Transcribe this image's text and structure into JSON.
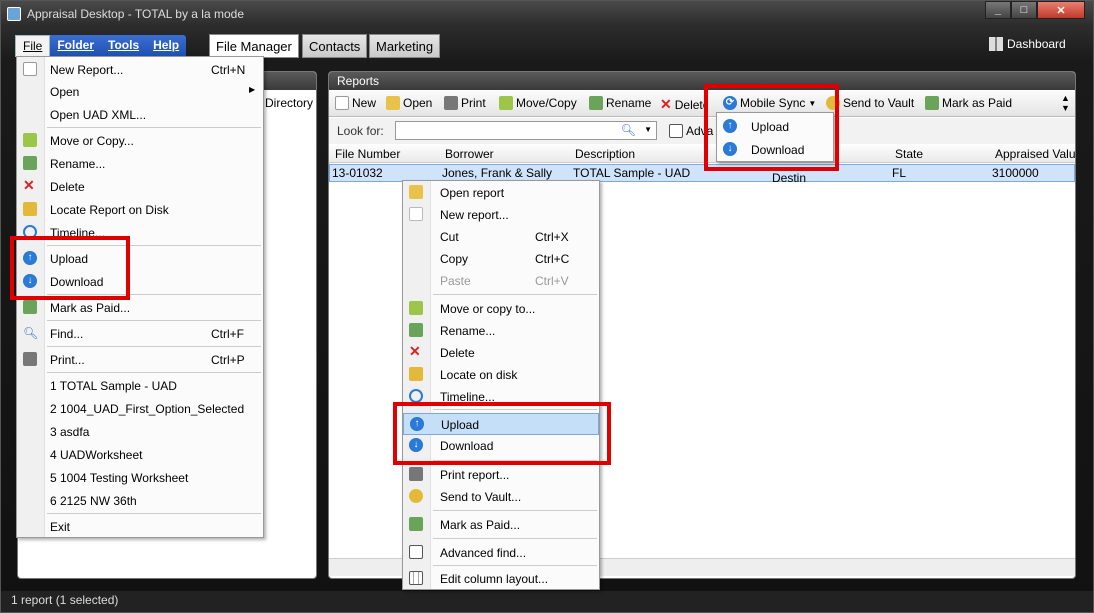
{
  "window": {
    "title": "Appraisal Desktop - TOTAL by a la mode"
  },
  "menubar": {
    "items": [
      "File",
      "Folder",
      "Tools",
      "Help"
    ]
  },
  "tabs": [
    "File Manager",
    "Contacts",
    "Marketing"
  ],
  "dashboard": {
    "label": "Dashboard"
  },
  "left_panel": {
    "directory_label": "Directory"
  },
  "reports": {
    "header": "Reports",
    "toolbar": [
      "New",
      "Open",
      "Print",
      "Move/Copy",
      "Rename",
      "Delete",
      "Mobile Sync",
      "Send to Vault",
      "Mark as Paid"
    ],
    "look_for_label": "Look for:",
    "look_for_value": "",
    "advanced_label": "Adva",
    "columns": [
      "File Number",
      "Borrower",
      "Description",
      "State",
      "Appraised Valu"
    ],
    "row": {
      "file_number": "13-01032",
      "borrower": "Jones, Frank & Sally",
      "description": "TOTAL Sample - UAD",
      "city_partial": "Destin",
      "state": "FL",
      "appraised_value": "3100000"
    }
  },
  "file_menu": {
    "new_report": "New Report...",
    "new_report_sc": "Ctrl+N",
    "open": "Open",
    "open_uad": "Open UAD XML...",
    "move_copy": "Move or Copy...",
    "rename": "Rename...",
    "delete": "Delete",
    "locate": "Locate Report on Disk",
    "timeline": "Timeline...",
    "upload": "Upload",
    "download": "Download",
    "mark_paid": "Mark as Paid...",
    "find": "Find...",
    "find_sc": "Ctrl+F",
    "print": "Print...",
    "print_sc": "Ctrl+P",
    "recent": [
      "1  TOTAL Sample - UAD",
      "2  1004_UAD_First_Option_Selected",
      "3  asdfa",
      "4  UADWorksheet",
      "5  1004 Testing Worksheet",
      "6  2125 NW 36th"
    ],
    "exit": "Exit"
  },
  "context_menu": {
    "open_report": "Open report",
    "new_report": "New report...",
    "cut": "Cut",
    "cut_sc": "Ctrl+X",
    "copy": "Copy",
    "copy_sc": "Ctrl+C",
    "paste": "Paste",
    "paste_sc": "Ctrl+V",
    "move_copy": "Move or copy to...",
    "rename": "Rename...",
    "delete": "Delete",
    "locate": "Locate on disk",
    "timeline": "Timeline...",
    "upload": "Upload",
    "download": "Download",
    "print": "Print report...",
    "vault": "Send to Vault...",
    "mark_paid": "Mark as Paid...",
    "adv_find": "Advanced find...",
    "edit_cols": "Edit column layout..."
  },
  "sync_menu": {
    "upload": "Upload",
    "download": "Download"
  },
  "status": {
    "text": "1 report (1 selected)"
  },
  "colors": {
    "highlight_box": "#e00000",
    "menubar": "#1d4fb0",
    "selection": "#cfe3fb"
  }
}
